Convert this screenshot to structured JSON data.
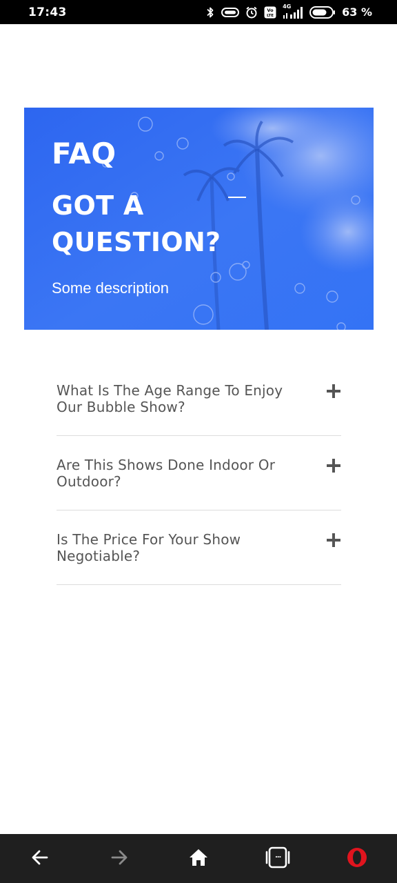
{
  "status_bar": {
    "time": "17:43",
    "battery_percent": "63 %",
    "icons": [
      "bluetooth-icon",
      "vibrate-icon",
      "alarm-icon",
      "volte-icon",
      "signal-4g-icon",
      "battery-icon"
    ],
    "network_label": "4G"
  },
  "hero": {
    "title": "FAQ",
    "subtitle": "GOT A QUESTION?",
    "description": "Some description",
    "accent_color": "#2f6bf2"
  },
  "faq": {
    "items": [
      {
        "question": "What Is The Age Range To Enjoy Our Bubble Show?",
        "icon": "plus-icon"
      },
      {
        "question": "Are This Shows Done Indoor Or Outdoor?",
        "icon": "plus-icon"
      },
      {
        "question": "Is The Price For Your Show Negotiable?",
        "icon": "plus-icon"
      }
    ]
  },
  "bottom_nav": {
    "icons": [
      "back-arrow-icon",
      "forward-arrow-icon",
      "home-icon",
      "tabs-icon",
      "opera-logo-icon"
    ],
    "tabs_label": "...",
    "brand_color": "#e0141e"
  }
}
